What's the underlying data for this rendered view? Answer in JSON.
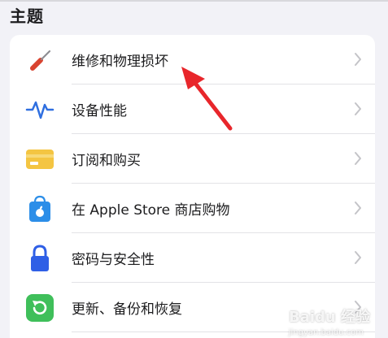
{
  "section": {
    "title": "主题"
  },
  "items": [
    {
      "label": "维修和物理损坏",
      "icon": "screwdriver-icon"
    },
    {
      "label": "设备性能",
      "icon": "pulse-icon"
    },
    {
      "label": "订阅和购买",
      "icon": "card-icon"
    },
    {
      "label": "在 Apple Store 商店购物",
      "icon": "apple-store-bag-icon"
    },
    {
      "label": "密码与安全性",
      "icon": "lock-icon"
    },
    {
      "label": "更新、备份和恢复",
      "icon": "restore-icon"
    }
  ],
  "colors": {
    "background": "#f2f2f7",
    "card": "#ffffff",
    "annotation_arrow": "#e8262b",
    "pulse": "#2f6fe0",
    "card_yellow": "#f4c542",
    "store_blue": "#2c8ee8",
    "lock_blue": "#2f5fe6",
    "restore_green": "#3fbf5a"
  },
  "watermark": {
    "text": "Baidu 经验",
    "subtext": "jingyan.baidu.com"
  }
}
